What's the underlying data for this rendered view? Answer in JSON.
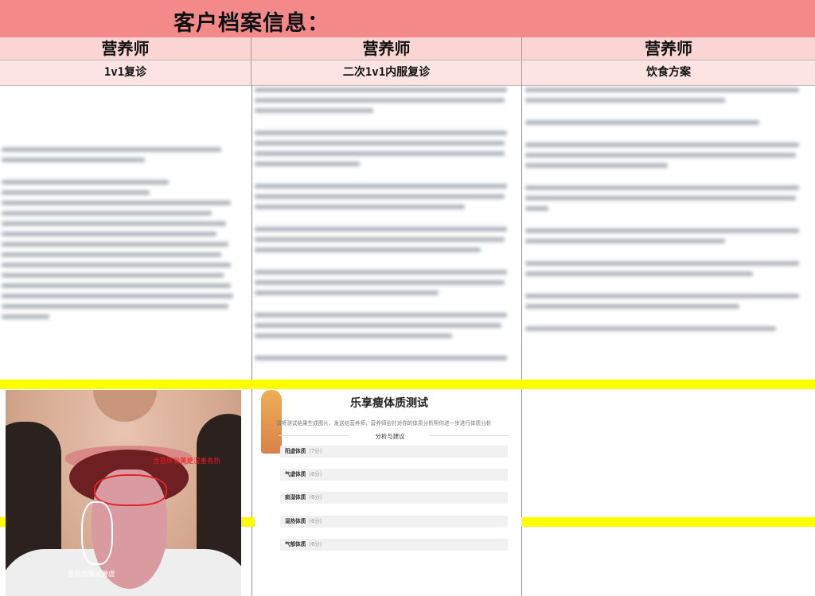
{
  "header": {
    "title": "客户档案信息："
  },
  "columns": [
    {
      "role": "营养师",
      "label": "1v1复诊"
    },
    {
      "role": "营养师",
      "label": "二次1v1内服复诊"
    },
    {
      "role": "营养师",
      "label": "饮食方案"
    }
  ],
  "tongue_photo": {
    "annotation_top": "舌苔厚偏黄是湿重有热",
    "annotation_bottom": "舌有齿痕是脾虚"
  },
  "report": {
    "title": "乐享瘦体质测试",
    "subtitle": "请将测试结果生成图片，发送给营养师，营养师会针对你的体质分析帮你进一步进行体质分析",
    "section": "分析与建议",
    "items": [
      {
        "name": "阳虚体质",
        "score": "(7分)"
      },
      {
        "name": "气虚体质",
        "score": "(6分)"
      },
      {
        "name": "痰湿体质",
        "score": "(6分)"
      },
      {
        "name": "湿热体质",
        "score": "(6分)"
      },
      {
        "name": "气郁体质",
        "score": "(6分)"
      }
    ]
  },
  "colors": {
    "title_bg": "#f4898a",
    "header_bg": "#fbd4d4",
    "subheader_bg": "#fde3e3",
    "highlight": "#ffff00",
    "annotation": "#e81e1e"
  }
}
